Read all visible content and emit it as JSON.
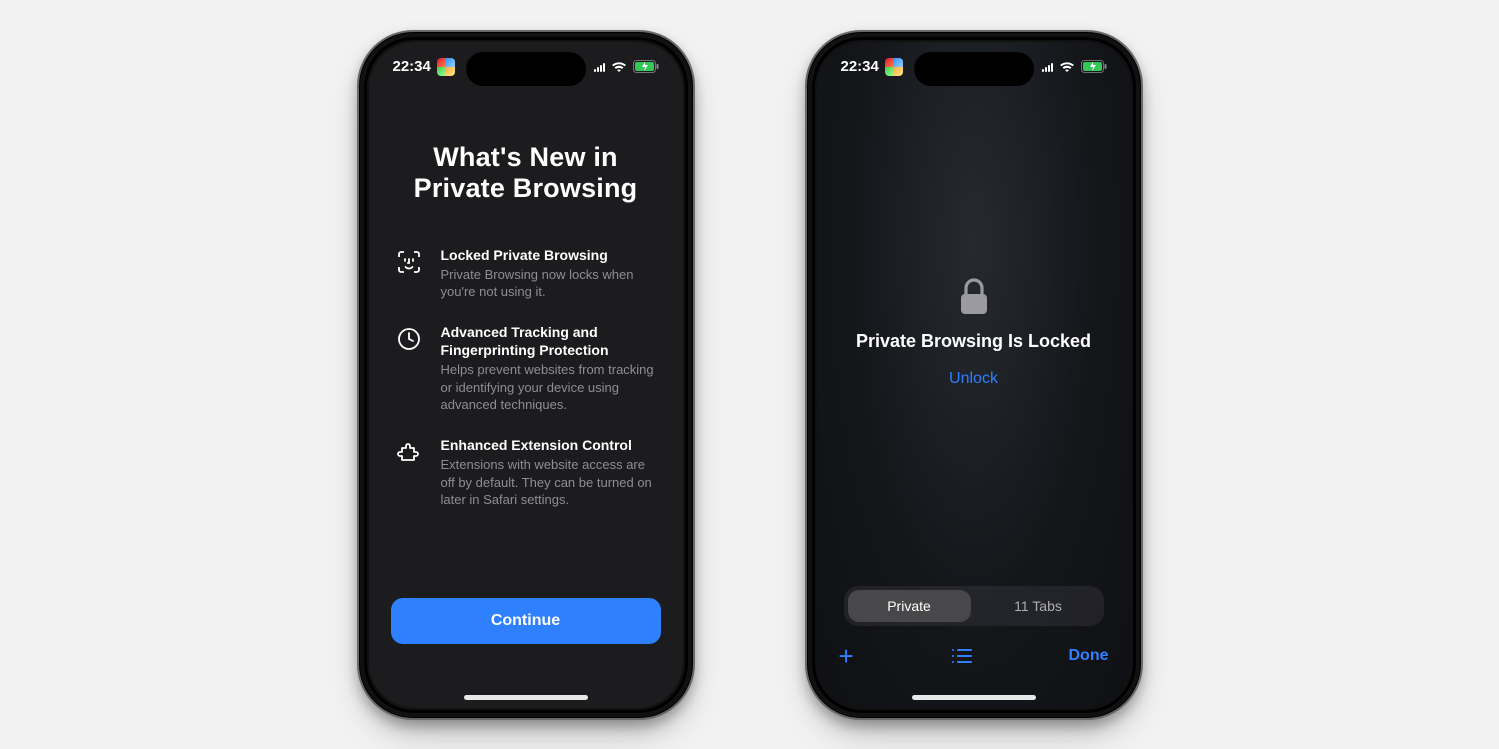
{
  "status": {
    "time": "22:34"
  },
  "screenA": {
    "title_line1": "What's New in",
    "title_line2": "Private Browsing",
    "features": [
      {
        "title": "Locked Private Browsing",
        "desc": "Private Browsing now locks when you're not using it."
      },
      {
        "title": "Advanced Tracking and Fingerprinting Protection",
        "desc": "Helps prevent websites from tracking or identifying your device using advanced techniques."
      },
      {
        "title": "Enhanced Extension Control",
        "desc": "Extensions with website access are off by default. They can be turned on later in Safari settings."
      }
    ],
    "continue_label": "Continue"
  },
  "screenB": {
    "locked_title": "Private Browsing Is Locked",
    "unlock_label": "Unlock",
    "tabs": {
      "private_label": "Private",
      "other_label": "11 Tabs"
    },
    "toolbar": {
      "done_label": "Done"
    }
  }
}
